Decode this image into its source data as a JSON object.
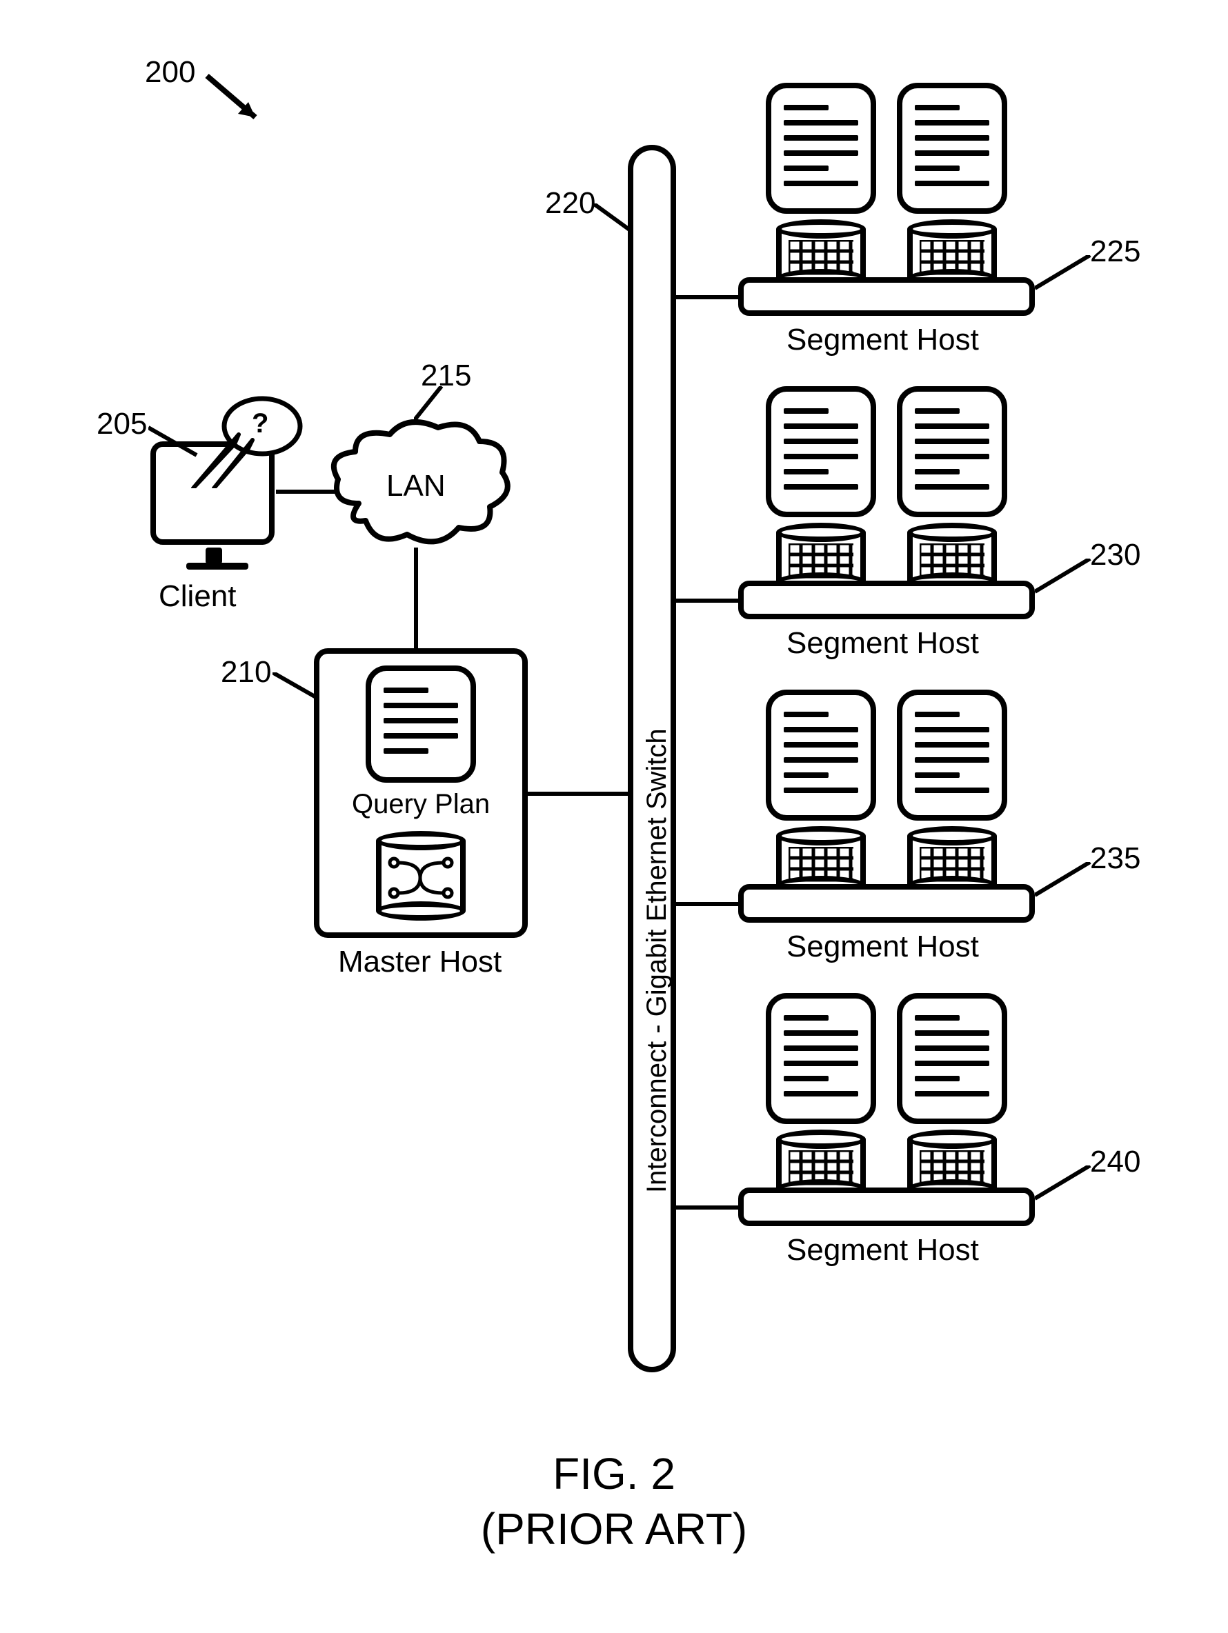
{
  "figure_ref": "200",
  "labels": {
    "client": "Client",
    "lan": "LAN",
    "master_host": "Master Host",
    "query_plan": "Query Plan",
    "switch": "Interconnect - Gigabit Ethernet Switch",
    "segment_host": "Segment Host"
  },
  "refs": {
    "client": "205",
    "master_host": "210",
    "lan": "215",
    "switch": "220",
    "seg1": "225",
    "seg2": "230",
    "seg3": "235",
    "seg4": "240"
  },
  "caption": {
    "line1": "FIG. 2",
    "line2": "(PRIOR ART)"
  },
  "question_mark": "?"
}
